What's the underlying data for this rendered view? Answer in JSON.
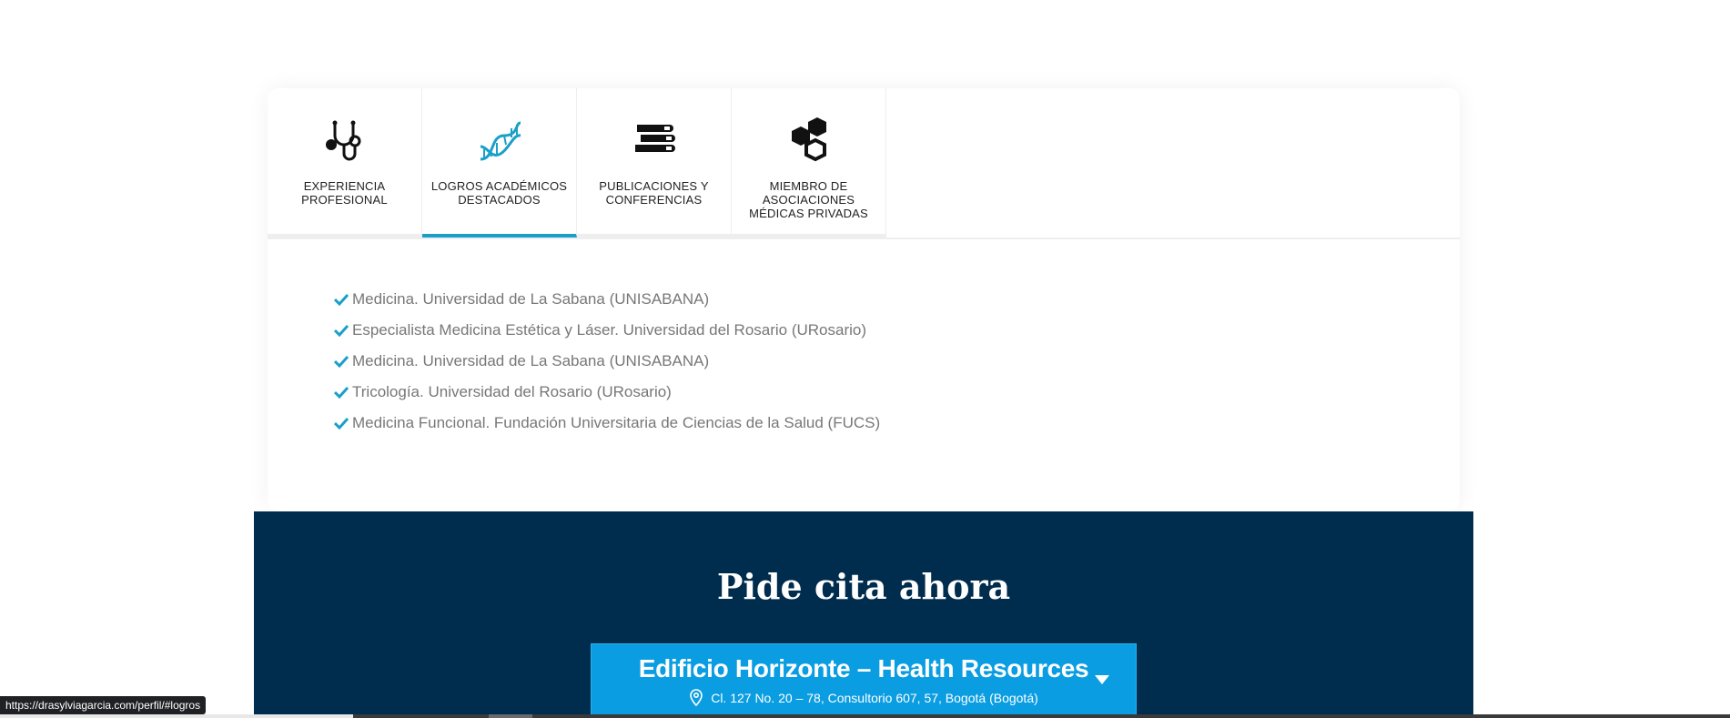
{
  "tabs": [
    {
      "label_line1": "EXPERIENCIA",
      "label_line2": "PROFESIONAL",
      "label_line3": "",
      "icon": "stethoscope-icon",
      "active": false
    },
    {
      "label_line1": "LOGROS ACADÉMICOS",
      "label_line2": "DESTACADOS",
      "label_line3": "",
      "icon": "dna-icon",
      "active": true
    },
    {
      "label_line1": "PUBLICACIONES Y",
      "label_line2": "CONFERENCIAS",
      "label_line3": "",
      "icon": "books-icon",
      "active": false
    },
    {
      "label_line1": "MIEMBRO DE",
      "label_line2": "ASOCIACIONES",
      "label_line3": "MÉDICAS PRIVADAS",
      "icon": "hexagons-icon",
      "active": false
    }
  ],
  "achievements": [
    "Medicina. Universidad de La Sabana (UNISABANA)",
    "Especialista Medicina Estética y Láser. Universidad del Rosario (URosario)",
    "Medicina. Universidad de La Sabana (UNISABANA)",
    "Tricología. Universidad del Rosario (URosario)",
    "Medicina Funcional. Fundación Universitaria de Ciencias de la Salud (FUCS)"
  ],
  "appointment": {
    "title": "Pide cita ahora",
    "location_name": "Edificio Horizonte – Health Resources",
    "location_address": "Cl. 127 No. 20 – 78, Consultorio 607, 57, Bogotá (Bogotá)"
  },
  "status_bar": {
    "url": "https://drasylviagarcia.com/perfil/#logros"
  },
  "colors": {
    "accent": "#1aa0c8",
    "navy": "#002c4e",
    "select_blue": "#0a9de2"
  }
}
